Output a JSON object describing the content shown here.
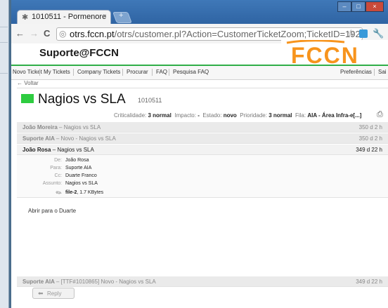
{
  "browser": {
    "tab_title": "1010511 - Pormenore",
    "tab_close": "×",
    "new_tab": "+",
    "url_host": "otrs.fccn.pt",
    "url_path": "/otrs/customer.pl?Action=CustomerTicketZoom;TicketID=192(",
    "controls": {
      "minimize": "–",
      "maximize": "□",
      "close": "×"
    },
    "icons": {
      "back": "←",
      "forward": "→",
      "reload": "C",
      "star": "☆",
      "wrench": "🔧"
    }
  },
  "site": {
    "title": "Suporte@FCCN",
    "logo_text": "FCCN",
    "logo_color": "#f7941d",
    "accent_color": "#2fae48"
  },
  "menu": {
    "items": [
      "Novo Ticket",
      "My Tickets",
      "Company Tickets",
      "Procurar",
      "FAQ",
      "Pesquisa FAQ"
    ],
    "right_items": [
      "Preferências",
      "Sai"
    ]
  },
  "ticket": {
    "back_link": "← Voltar",
    "title": "Nagios vs SLA",
    "number": "1010511",
    "status_color": "#2ecc40",
    "meta": [
      {
        "label": "Criticalidade:",
        "value": "3 normal"
      },
      {
        "label": "Impacto:",
        "value": "-"
      },
      {
        "label": "Estado:",
        "value": "novo"
      },
      {
        "label": "Prioridade:",
        "value": "3 normal"
      },
      {
        "label": "Fila:",
        "value": "AIA - Área Infra-e[...]"
      }
    ]
  },
  "articles": [
    {
      "from": "João Moreira",
      "subject": "– Nagios vs SLA",
      "age": "350 d 2 h"
    },
    {
      "from": "Suporte AIA",
      "subject": "– Novo - Nagios vs SLA",
      "age": "350 d 2 h"
    },
    {
      "from": "João Rosa",
      "subject": "– Nagios vs SLA",
      "age": "349 d 22 h"
    },
    {
      "from": "Suporte AIA",
      "subject": "– [TTF#1010865] Novo - Nagios vs SLA",
      "age": "349 d 22 h"
    }
  ],
  "detail": {
    "headers": [
      {
        "label": "De:",
        "value": "João Rosa"
      },
      {
        "label": "Para:",
        "value": "Suporte AIA"
      },
      {
        "label": "Cc:",
        "value": "Duarte Franco"
      },
      {
        "label": "Assunto:",
        "value": "Nagios vs SLA"
      }
    ],
    "attachment_name": "file-2",
    "attachment_size": ", 1.7 KBytes",
    "body": "Abrir para o Duarte"
  },
  "reply": {
    "label": "Reply",
    "icon": "⬅"
  }
}
